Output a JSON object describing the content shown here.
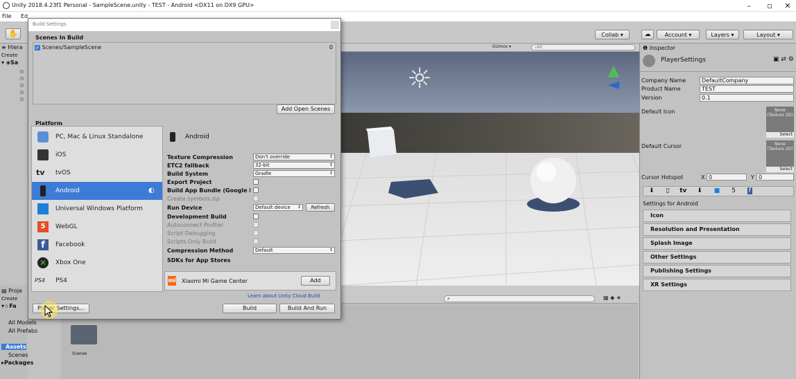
{
  "titlebar": {
    "title": "Unity 2018.4.23f1 Personal - SampleScene.unity - TEST - Android <DX11 on DX9 GPU>",
    "minimize": "–",
    "maximize": "▫",
    "close": "✕"
  },
  "menubar": {
    "items": [
      "File",
      "Ed"
    ]
  },
  "toolbar": {
    "collab": "Collab ▾",
    "cloud_icon": "cloud-icon",
    "account": "Account",
    "layers": "Layers",
    "layout": "Layout"
  },
  "hierarchy": {
    "title": "Hiera",
    "create": "Create",
    "scene": "Sa"
  },
  "project": {
    "title": "Proje",
    "create": "Create",
    "favorites": "Fa",
    "all_models": "All Models",
    "all_prefabs": "All Prefabs",
    "assets": "Assets",
    "scenes": "Scenes",
    "packages": "Packages",
    "folder_label": "Scenes"
  },
  "scene_view": {
    "gizmos": "Gizmos ▾",
    "search": "All"
  },
  "inspector": {
    "tab": "Inspector",
    "title": "PlayerSettings",
    "company_label": "Company Name",
    "company_value": "DefaultCompany",
    "product_label": "Product Name",
    "product_value": "TEST",
    "version_label": "Version",
    "version_value": "0.1",
    "default_icon": "Default Icon",
    "default_cursor": "Default Cursor",
    "none_texture": "None (Texture 2D)",
    "select": "Select",
    "cursor_hotspot": "Cursor Hotspot",
    "x_label": "X",
    "x_value": "0",
    "y_label": "Y",
    "y_value": "0",
    "settings_for": "Settings for Android",
    "sections": [
      "Icon",
      "Resolution and Presentation",
      "Splash Image",
      "Other Settings",
      "Publishing Settings",
      "XR Settings"
    ]
  },
  "dialog": {
    "title": "Build Settings",
    "scenes_in_build": "Scenes In Build",
    "scene_entry": "Scenes/SampleScene",
    "scene_index": "0",
    "add_open_scenes": "Add Open Scenes",
    "platform_header": "Platform",
    "platforms": [
      "PC, Mac & Linux Standalone",
      "iOS",
      "tvOS",
      "Android",
      "Universal Windows Platform",
      "WebGL",
      "Facebook",
      "Xbox One",
      "PS4"
    ],
    "selected_platform": "Android",
    "ps4_logo": "PS4",
    "tv_logo": "tv",
    "settings": {
      "texture_compression": "Texture Compression",
      "texture_compression_value": "Don't override",
      "etc2": "ETC2 fallback",
      "etc2_value": "32-bit",
      "build_system": "Build System",
      "build_system_value": "Gradle",
      "export_project": "Export Project",
      "app_bundle": "Build App Bundle (Google Play)",
      "create_symbols": "Create symbols.zip",
      "run_device": "Run Device",
      "run_device_value": "Default device",
      "refresh": "Refresh",
      "dev_build": "Development Build",
      "autoconnect": "Autoconnect Profiler",
      "script_debug": "Script Debugging",
      "scripts_only": "Scripts Only Build",
      "compression": "Compression Method",
      "compression_value": "Default",
      "sdks": "SDKs for App Stores",
      "xiaomi": "Xiaomi Mi Game Center",
      "add": "Add",
      "cloud_link": "Learn about Unity Cloud Build"
    },
    "player_settings": "Player Settings...",
    "build": "Build",
    "build_and_run": "Build And Run"
  }
}
